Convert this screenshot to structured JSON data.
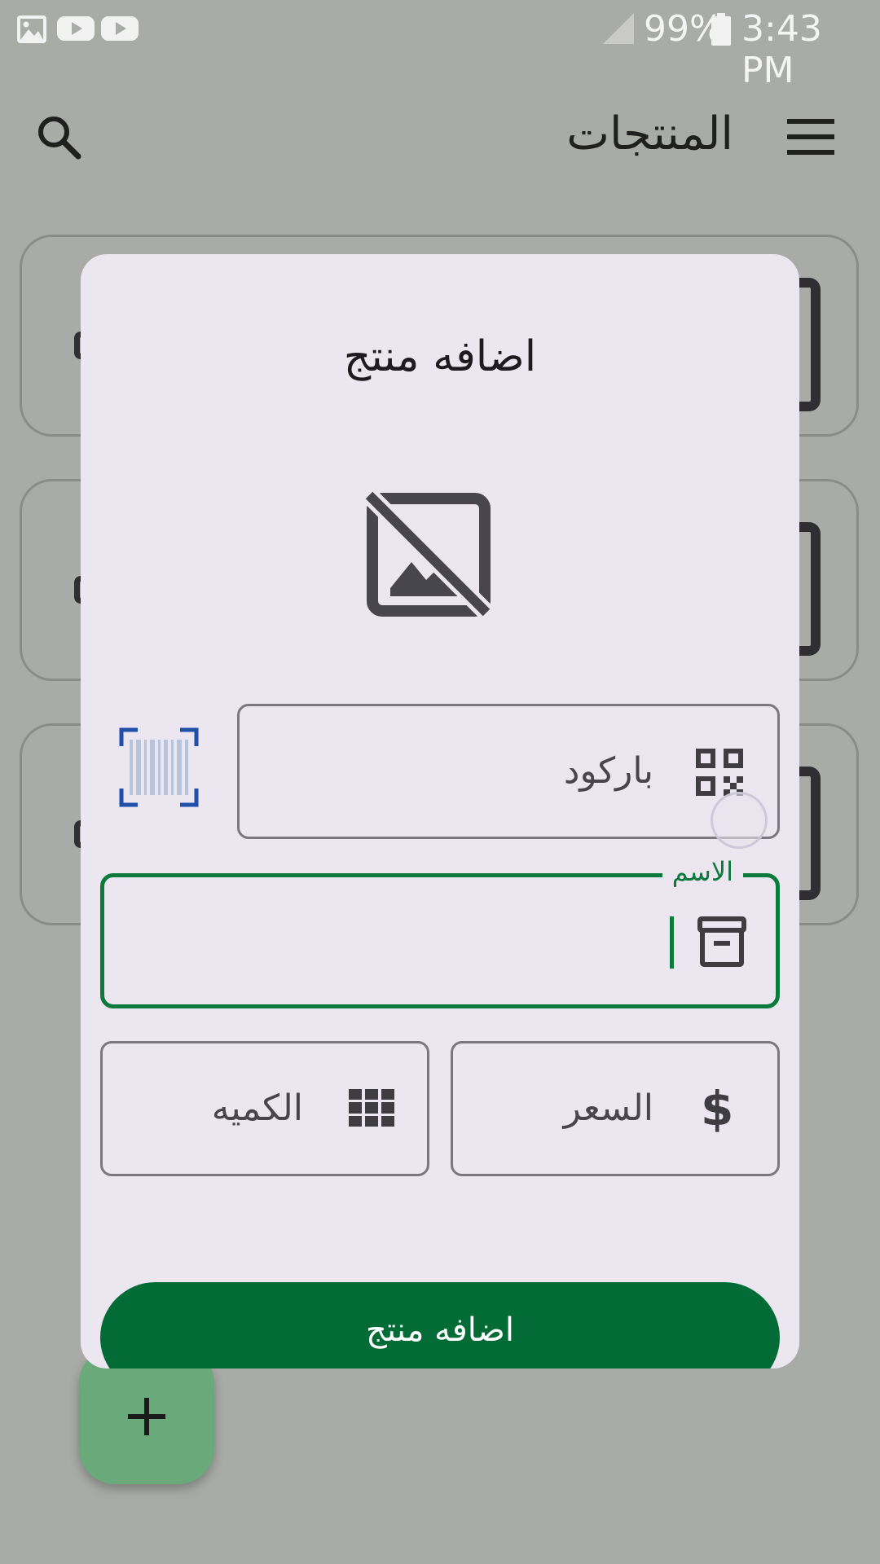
{
  "status_bar": {
    "battery": "99%",
    "time": "3:43 PM",
    "notification_icons": [
      "image-icon",
      "youtube-icon",
      "youtube-icon"
    ]
  },
  "app_bar": {
    "title": "المنتجات",
    "menu_icon": "menu-icon",
    "search_icon": "search-icon"
  },
  "dialog": {
    "title": "اضافه منتج",
    "image_placeholder_icon": "hide-image-icon",
    "barcode": {
      "placeholder": "باركود",
      "icon": "qr-code-icon",
      "scan_icon": "barcode-scanner-icon"
    },
    "name": {
      "label": "الاسم",
      "value": "",
      "icon": "archive-box-icon"
    },
    "quantity": {
      "placeholder": "الكميه",
      "icon": "grid-icon"
    },
    "price": {
      "placeholder": "السعر",
      "icon": "dollar-icon"
    },
    "submit_label": "اضافه منتج"
  },
  "fab": {
    "icon": "plus-icon"
  },
  "colors": {
    "primary": "#036b36",
    "focus": "#0b7a3b",
    "dialog_bg": "#ebe6ef",
    "scrim": "#a9aba7",
    "fab": "#6aaa7a"
  }
}
